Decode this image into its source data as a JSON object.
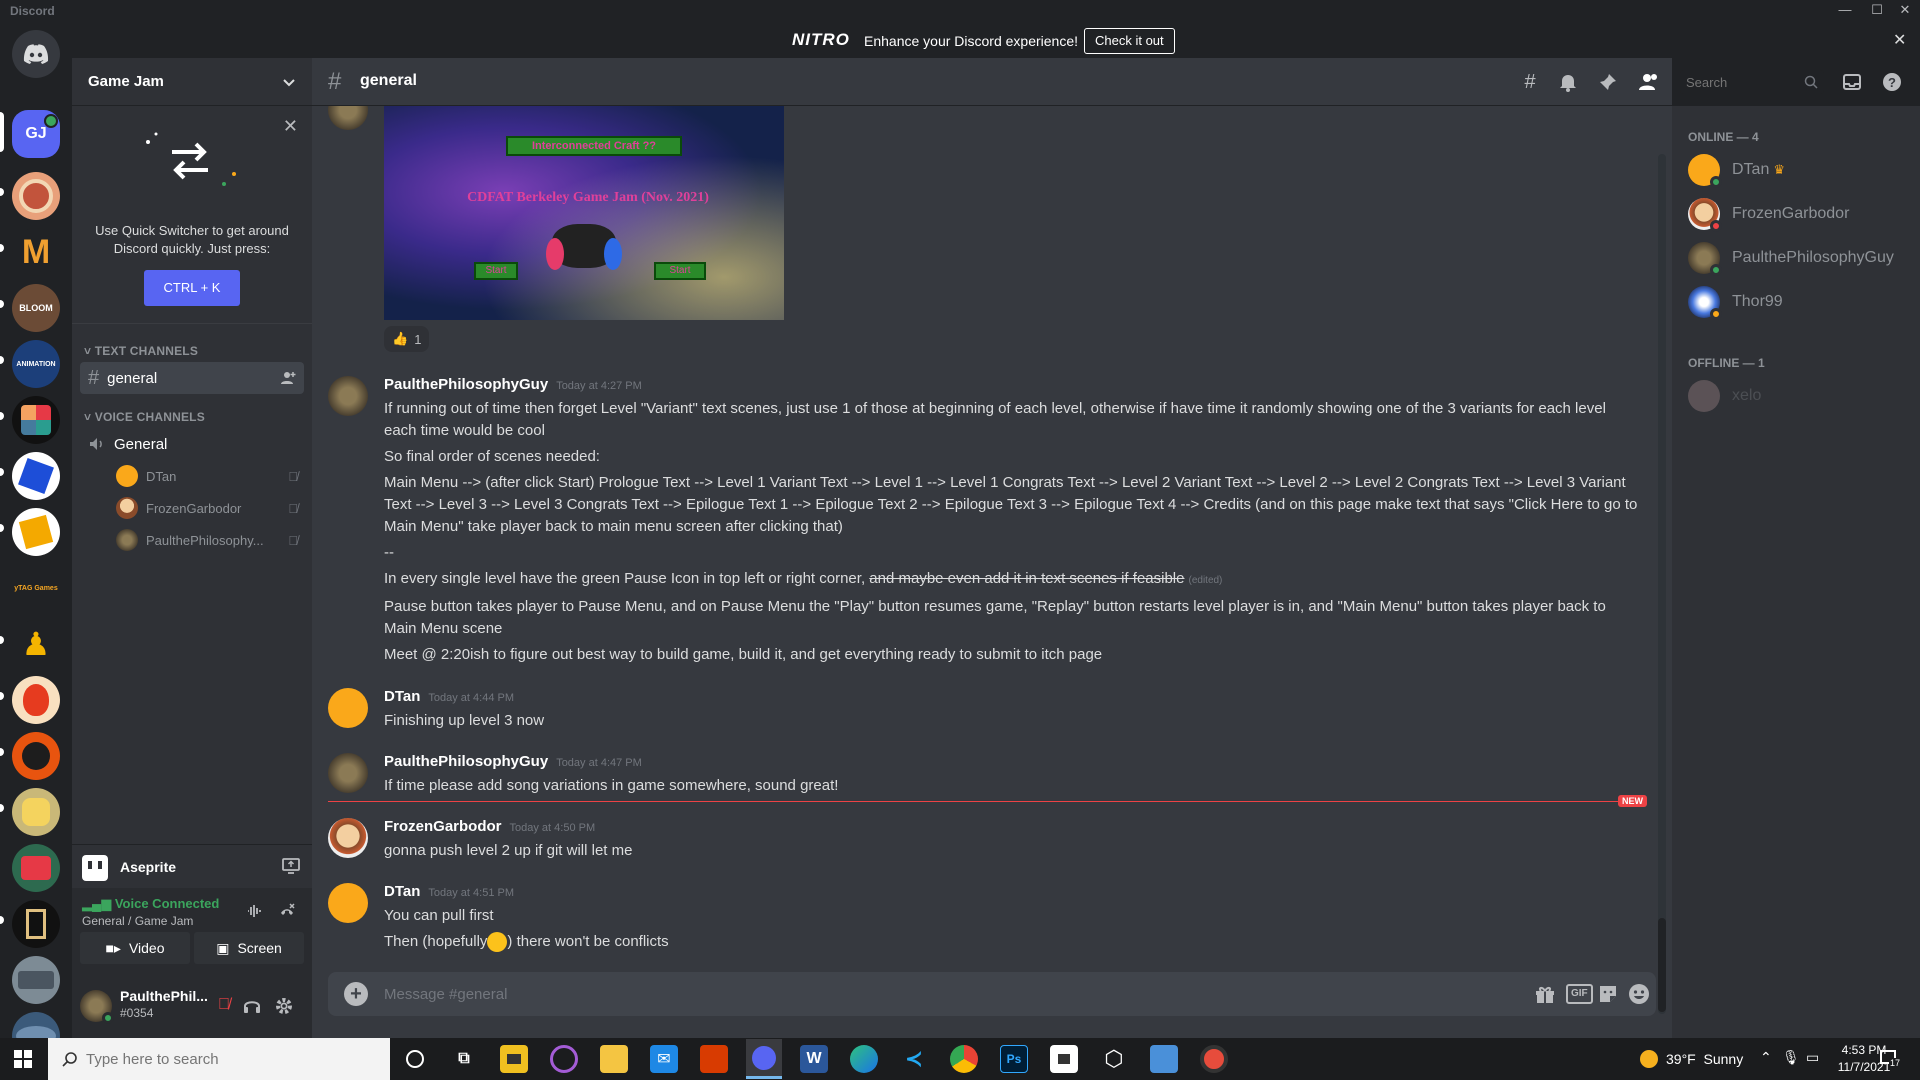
{
  "app_title": "Discord",
  "nitro": {
    "logo": "NITRO",
    "message": "Enhance your Discord experience!",
    "cta": "Check it out"
  },
  "rail": {
    "home_label": "",
    "active_server_initials": "GJ",
    "ytag_label": "yTAG Games"
  },
  "guild": {
    "name": "Game Jam"
  },
  "quick_switcher": {
    "text": "Use Quick Switcher to get around Discord quickly. Just press:",
    "shortcut": "CTRL + K"
  },
  "text_channels": {
    "category": "TEXT CHANNELS",
    "channels": [
      {
        "name": "general"
      }
    ]
  },
  "voice_channels": {
    "category": "VOICE CHANNELS",
    "channel": "General",
    "users": [
      "DTan",
      "FrozenGarbodor",
      "PaulthePhilosophy..."
    ]
  },
  "activity": {
    "name": "Aseprite"
  },
  "voice_status": {
    "label": "Voice Connected",
    "location": "General / Game Jam",
    "video_label": "Video",
    "screen_label": "Screen"
  },
  "user_panel": {
    "name": "PaulthePhil...",
    "tag": "#0354"
  },
  "chat": {
    "channel_name": "general",
    "search_placeholder": "Search",
    "image_banner": {
      "title": "Interconnected Craft ??",
      "subtitle": "CDFAT Berkeley Game Jam (Nov. 2021)",
      "left_btn": "Start",
      "right_btn": "Start"
    },
    "reaction": {
      "emoji": "👍",
      "count": "1"
    },
    "messages": [
      {
        "author": "PaulthePhilosophyGuy",
        "timestamp": "Today at 4:27 PM",
        "lines": [
          "If running out of time then forget Level \"Variant\" text scenes, just use 1 of those at beginning of each level, otherwise if have time it randomly showing one of the 3 variants for each level each time would be cool",
          "So final order of scenes needed:",
          "Main Menu --> (after click Start) Prologue Text --> Level 1 Variant Text --> Level 1 --> Level 1 Congrats Text --> Level 2 Variant Text --> Level 2 --> Level 2 Congrats Text --> Level 3 Variant Text --> Level 3 --> Level 3 Congrats Text --> Epilogue Text 1 --> Epilogue Text 2 --> Epilogue Text 3 --> Epilogue Text 4 --> Credits (and on this page make text that says \"Click Here to go to Main Menu\" take player back to main menu screen after clicking that)",
          "--",
          "In every single level have the green Pause Icon in top left or right corner, ",
          "Pause button takes player to Pause Menu, and on Pause Menu the \"Play\" button resumes game, \"Replay\" button restarts level player is in, and \"Main Menu\" button takes player back to Main Menu scene",
          "Meet @ 2:20ish to figure out best way to build game, build it, and get everything ready to submit to itch page"
        ],
        "strike_text": "and maybe even add it in text scenes if feasible",
        "edited": "(edited)"
      },
      {
        "author": "DTan",
        "timestamp": "Today at 4:44 PM",
        "lines": [
          "Finishing up level 3 now"
        ]
      },
      {
        "author": "PaulthePhilosophyGuy",
        "timestamp": "Today at 4:47 PM",
        "lines": [
          "If time please add song variations in game somewhere, sound great!"
        ]
      },
      {
        "author": "FrozenGarbodor",
        "timestamp": "Today at 4:50 PM",
        "lines": [
          "gonna push level 2 up if git will let me"
        ]
      },
      {
        "author": "DTan",
        "timestamp": "Today at 4:51 PM",
        "lines": [
          "You can pull first",
          "Then (hopefully",
          ") there won't be conflicts"
        ]
      }
    ],
    "new_badge": "NEW",
    "composer_placeholder": "Message #general",
    "gif_label": "GIF"
  },
  "members": {
    "online_header": "ONLINE — 4",
    "online": [
      {
        "name": "DTan",
        "status_color": "#3ba55d"
      },
      {
        "name": "FrozenGarbodor",
        "status_color": "#ed4245"
      },
      {
        "name": "PaulthePhilosophyGuy",
        "status_color": "#3ba55d"
      },
      {
        "name": "Thor99",
        "status_color": "#faa81a"
      }
    ],
    "offline_header": "OFFLINE — 1",
    "offline": [
      {
        "name": "xelo"
      }
    ]
  },
  "taskbar": {
    "search_placeholder": "Type here to search",
    "weather": "39°F  Sunny",
    "time": "4:53 PM",
    "date": "11/7/2021",
    "notification_count": "17"
  },
  "colors": {
    "accent": "#5865f2",
    "green": "#3ba55d",
    "red": "#ed4245"
  }
}
